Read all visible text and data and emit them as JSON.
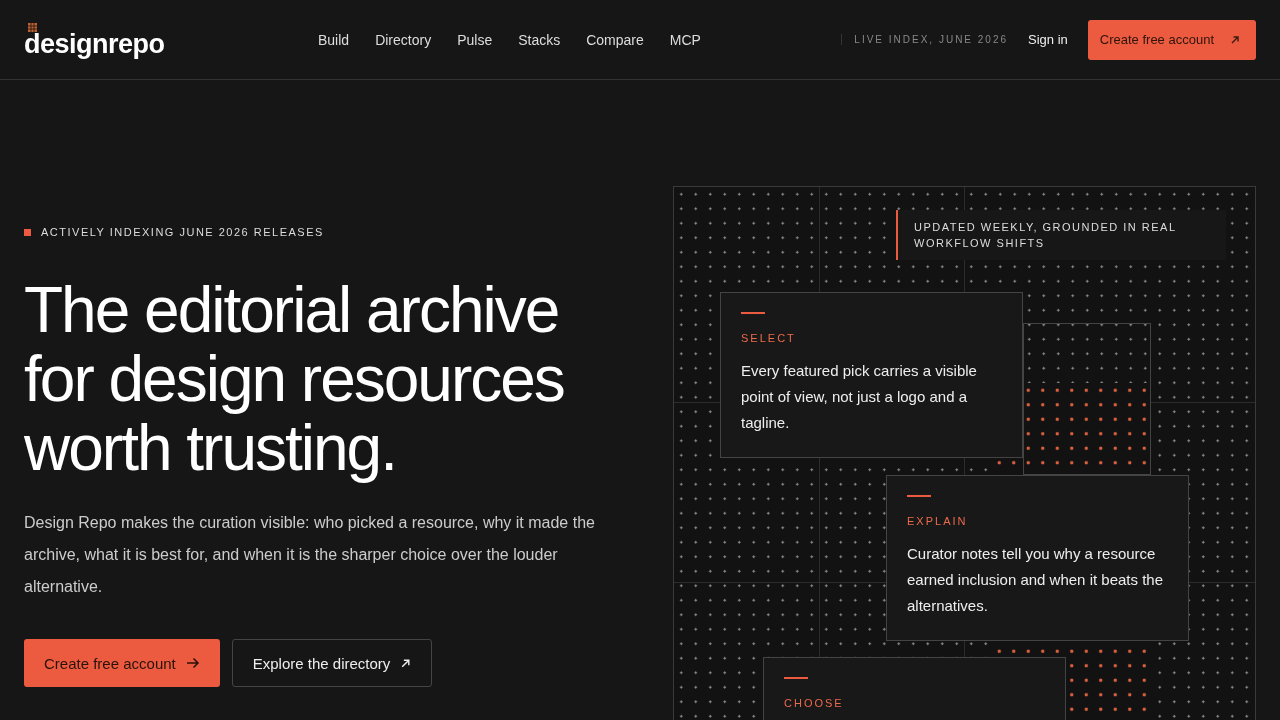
{
  "header": {
    "logo": "designrepo",
    "nav": [
      {
        "label": "Build"
      },
      {
        "label": "Directory"
      },
      {
        "label": "Pulse"
      },
      {
        "label": "Stacks"
      },
      {
        "label": "Compare"
      },
      {
        "label": "MCP"
      }
    ],
    "live_index": "LIVE INDEX, JUNE 2026",
    "sign_in": "Sign in",
    "cta": "Create free account"
  },
  "hero": {
    "eyebrow": "ACTIVELY INDEXING JUNE 2026 RELEASES",
    "headline": [
      "The editorial archive",
      "for design resources",
      "worth trusting."
    ],
    "intro": "Design Repo makes the curation visible: who picked a resource, why it made the archive, what it is best for, and when it is the sharper choice over the louder alternative.",
    "primary_button": "Create free account",
    "secondary_button": "Explore the directory"
  },
  "panel": {
    "note": "UPDATED WEEKLY, GROUNDED IN REAL WORKFLOW SHIFTS",
    "cards": [
      {
        "label": "SELECT",
        "text": "Every featured pick carries a visible point of view, not just a logo and a tagline."
      },
      {
        "label": "EXPLAIN",
        "text": "Curator notes tell you why a resource earned inclusion and when it beats the alternatives."
      },
      {
        "label": "CHOOSE"
      }
    ]
  }
}
